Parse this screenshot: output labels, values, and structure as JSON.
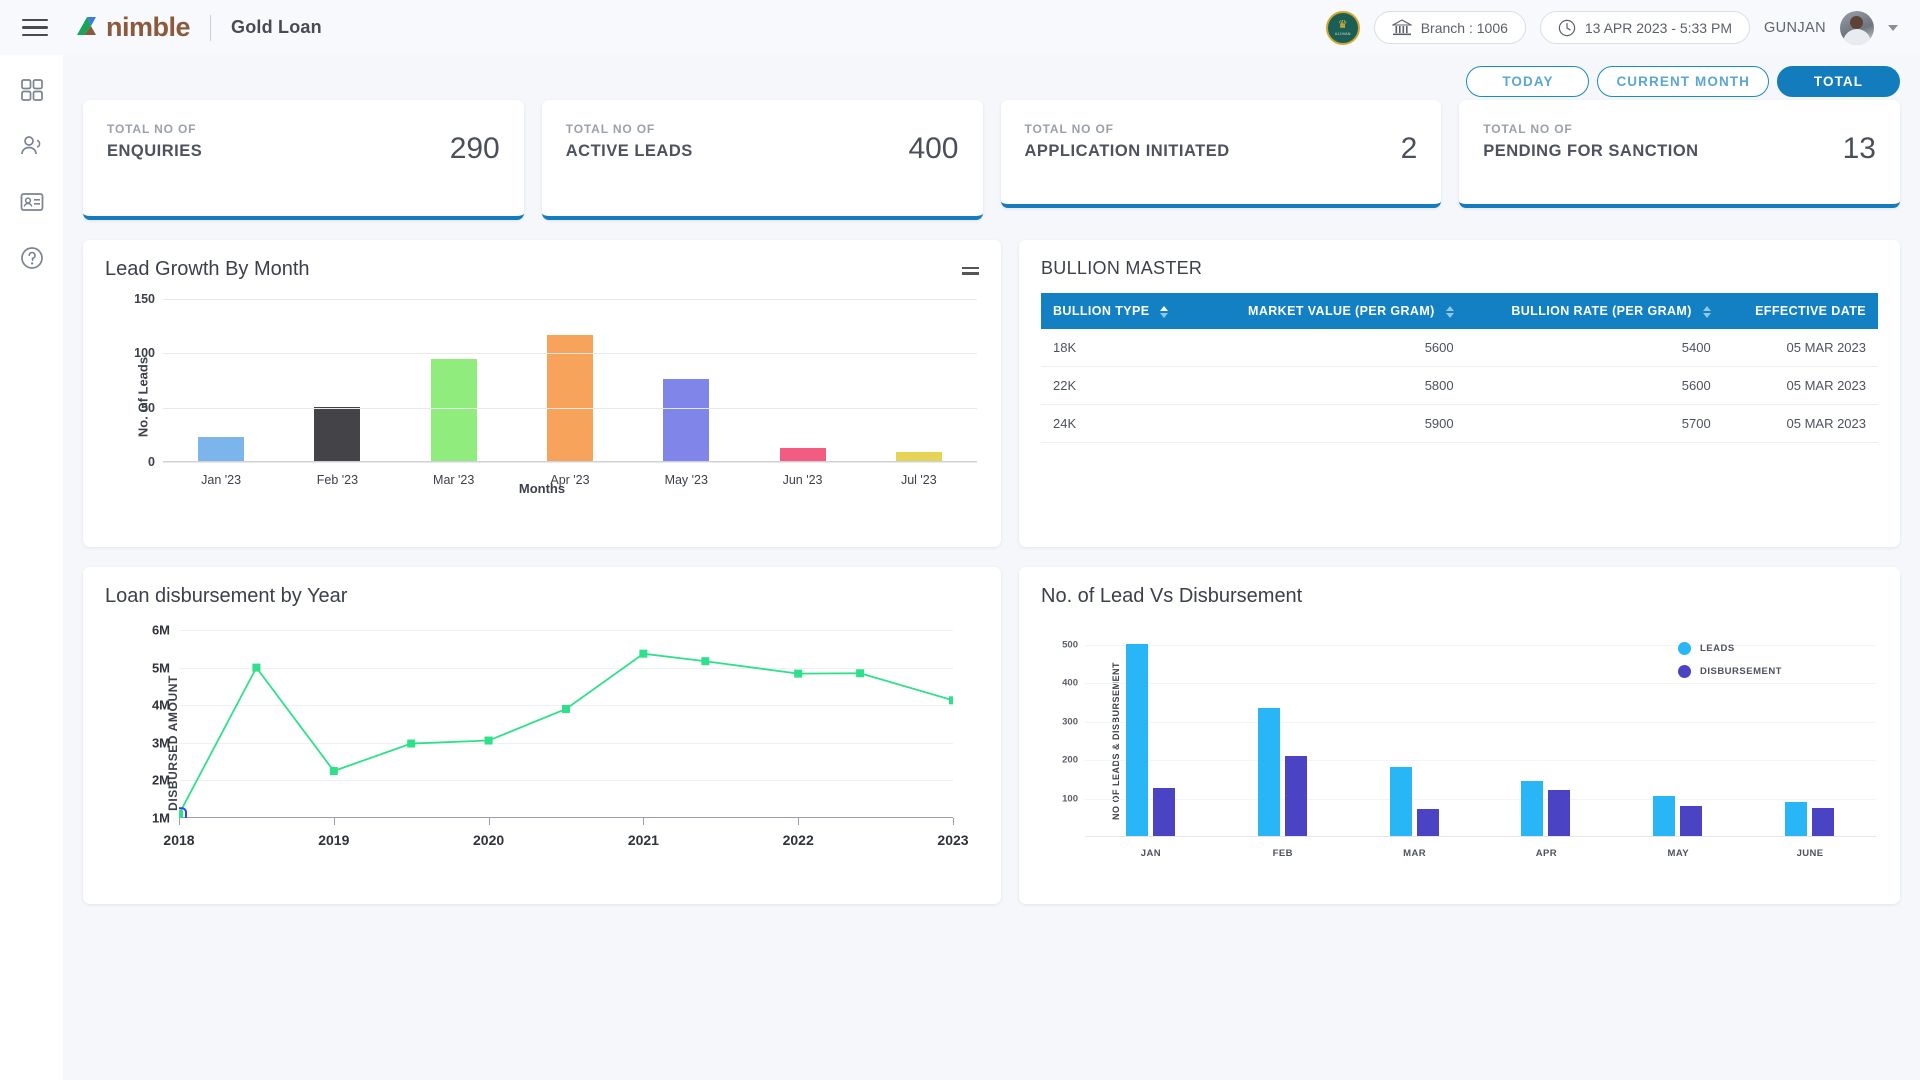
{
  "header": {
    "menu_icon": "hamburger-icon",
    "brand": "nimble",
    "app_title": "Gold Loan",
    "bank_logo_text": "UJJIVAN",
    "branch": "Branch : 1006",
    "datetime": "13 APR 2023 - 5:33 PM",
    "username": "GUNJAN"
  },
  "sidebar": {
    "items": [
      {
        "name": "dashboard-grid-icon",
        "label": "Dashboard"
      },
      {
        "name": "customers-icon",
        "label": "Customers"
      },
      {
        "name": "application-form-icon",
        "label": "Applications"
      },
      {
        "name": "help-icon",
        "label": "Help"
      }
    ]
  },
  "filters": {
    "tabs": [
      {
        "label": "TODAY",
        "active": false
      },
      {
        "label": "CURRENT MONTH",
        "active": false
      },
      {
        "label": "TOTAL",
        "active": true
      }
    ]
  },
  "kpis": [
    {
      "prefix": "TOTAL NO OF",
      "title": "ENQUIRIES",
      "value": "290",
      "accent": "#127cbe"
    },
    {
      "prefix": "TOTAL NO OF",
      "title": "ACTIVE LEADS",
      "value": "400",
      "accent": "#127cbe"
    },
    {
      "prefix": "TOTAL NO OF",
      "title": "APPLICATION INITIATED",
      "value": "2",
      "accent": "#127cbe"
    },
    {
      "prefix": "TOTAL NO OF",
      "title": "PENDING FOR SANCTION",
      "value": "13",
      "accent": "#127cbe"
    }
  ],
  "bullion": {
    "title": "BULLION MASTER",
    "columns": [
      "BULLION TYPE",
      "MARKET VALUE (PER GRAM)",
      "BULLION RATE (PER GRAM)",
      "EFFECTIVE DATE"
    ],
    "rows": [
      {
        "type": "18K",
        "market_value": "5600",
        "bullion_rate": "5400",
        "effective_date": "05 MAR 2023"
      },
      {
        "type": "22K",
        "market_value": "5800",
        "bullion_rate": "5600",
        "effective_date": "05 MAR 2023"
      },
      {
        "type": "24K",
        "market_value": "5900",
        "bullion_rate": "5700",
        "effective_date": "05 MAR 2023"
      }
    ]
  },
  "chart_data": [
    {
      "id": "lead-growth",
      "type": "bar",
      "title": "Lead Growth By Month",
      "xlabel": "Months",
      "ylabel": "No. Of Leads",
      "ylim": [
        0,
        150
      ],
      "yticks": [
        0,
        50,
        100,
        150
      ],
      "categories": [
        "Jan '23",
        "Feb '23",
        "Mar '23",
        "Apr '23",
        "May '23",
        "Jun '23",
        "Jul '23"
      ],
      "values": [
        22,
        50,
        94,
        117,
        76,
        12,
        8
      ],
      "colors": [
        "#7cb5ec",
        "#434348",
        "#90ed7d",
        "#f7a35c",
        "#8085e9",
        "#f15c80",
        "#e4d354"
      ],
      "grid": true,
      "legend": "none"
    },
    {
      "id": "loan-disbursement",
      "type": "line",
      "title": "Loan disbursement by Year",
      "xlabel": "",
      "ylabel": "DISBURSED AMOUNT",
      "ylim": [
        1000000,
        6000000
      ],
      "yticks": [
        "1M",
        "2M",
        "3M",
        "4M",
        "5M",
        "6M"
      ],
      "xticks": [
        "2018",
        "2019",
        "2020",
        "2021",
        "2022",
        "2023"
      ],
      "series_color": "#2fe08a",
      "points": [
        {
          "x": 2018.0,
          "y": 1100000
        },
        {
          "x": 2018.5,
          "y": 5000000
        },
        {
          "x": 2019.0,
          "y": 2250000
        },
        {
          "x": 2019.5,
          "y": 2980000
        },
        {
          "x": 2020.0,
          "y": 3060000
        },
        {
          "x": 2020.5,
          "y": 3900000
        },
        {
          "x": 2021.0,
          "y": 5370000
        },
        {
          "x": 2021.4,
          "y": 5170000
        },
        {
          "x": 2022.0,
          "y": 4840000
        },
        {
          "x": 2022.4,
          "y": 4850000
        },
        {
          "x": 2023.0,
          "y": 4130000
        }
      ],
      "selected_point_index": 0,
      "grid": true,
      "legend": "none"
    },
    {
      "id": "lead-vs-disbursement",
      "type": "bar",
      "title": "No. of Lead Vs Disbursement",
      "xlabel": "",
      "ylabel": "NO OF LEADS & DISBURSEMENT",
      "ylim": [
        0,
        560
      ],
      "yticks": [
        100,
        200,
        300,
        400,
        500
      ],
      "categories": [
        "JAN",
        "FEB",
        "MAR",
        "APR",
        "MAY",
        "JUNE"
      ],
      "series": [
        {
          "name": "LEADS",
          "color": "#29b6f6",
          "values": [
            500,
            333,
            180,
            143,
            105,
            88
          ]
        },
        {
          "name": "DISBURSEMENT",
          "color": "#4a44c4",
          "values": [
            125,
            208,
            70,
            120,
            78,
            72
          ]
        }
      ],
      "grid": true,
      "legend": "top-right"
    }
  ]
}
